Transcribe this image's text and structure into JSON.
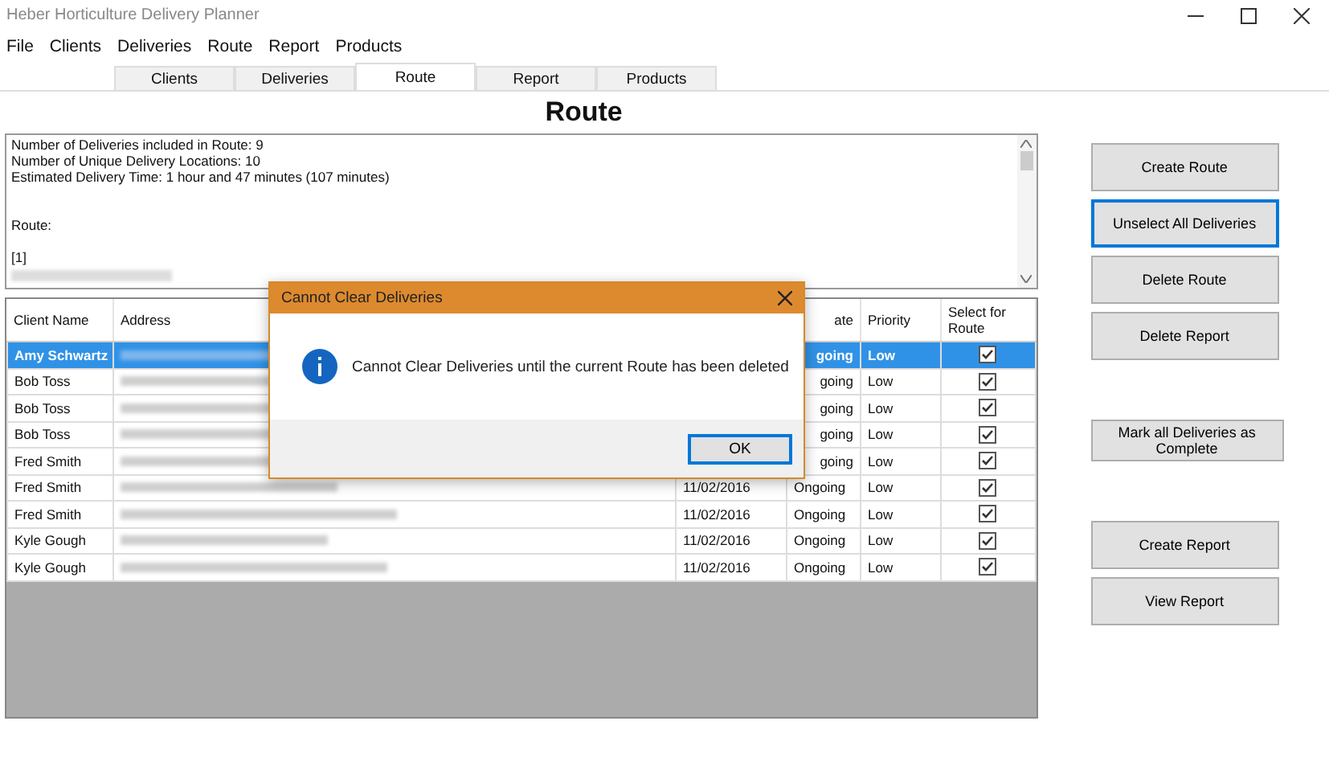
{
  "window": {
    "title": "Heber Horticulture Delivery Planner"
  },
  "menu": [
    "File",
    "Clients",
    "Deliveries",
    "Route",
    "Report",
    "Products"
  ],
  "tabs": [
    {
      "label": "Clients",
      "selected": false
    },
    {
      "label": "Deliveries",
      "selected": false
    },
    {
      "label": "Route",
      "selected": true
    },
    {
      "label": "Report",
      "selected": false
    },
    {
      "label": "Products",
      "selected": false
    }
  ],
  "heading": "Route",
  "summary": {
    "blocks": [
      [
        "Number of Deliveries included in Route: 9",
        "Number of Unique Delivery Locations: 10",
        "Estimated Delivery Time: 1 hour and 47 minutes (107 minutes)"
      ],
      [
        "Route:"
      ],
      [
        "[1]"
      ]
    ]
  },
  "table": {
    "columns": [
      "Client Name",
      "Address",
      "ate",
      "Priority",
      "Select for Route"
    ],
    "rows": [
      {
        "kind": "covered",
        "client": "Amy Schwartz",
        "status": "going",
        "priority": "Low",
        "checked": true,
        "selected": true
      },
      {
        "kind": "covered",
        "client": "Bob Toss",
        "status": "going",
        "priority": "Low",
        "checked": true,
        "selected": false
      },
      {
        "kind": "covered",
        "client": "Bob Toss",
        "status": "going",
        "priority": "Low",
        "checked": true,
        "selected": false
      },
      {
        "kind": "covered",
        "client": "Bob Toss",
        "status": "going",
        "priority": "Low",
        "checked": true,
        "selected": false
      },
      {
        "kind": "covered",
        "client": "Fred Smith",
        "status": "going",
        "priority": "Low",
        "checked": true,
        "selected": false
      },
      {
        "kind": "full",
        "client": "Fred Smith",
        "date": "11/02/2016",
        "status": "Ongoing",
        "priority": "Low",
        "checked": true,
        "selected": false
      },
      {
        "kind": "full",
        "client": "Fred Smith",
        "date": "11/02/2016",
        "status": "Ongoing",
        "priority": "Low",
        "checked": true,
        "selected": false
      },
      {
        "kind": "full",
        "client": "Kyle Gough",
        "date": "11/02/2016",
        "status": "Ongoing",
        "priority": "Low",
        "checked": true,
        "selected": false
      },
      {
        "kind": "full",
        "client": "Kyle Gough",
        "date": "11/02/2016",
        "status": "Ongoing",
        "priority": "Low",
        "checked": true,
        "selected": false
      }
    ]
  },
  "actions": [
    {
      "label": "Create Route",
      "focused": false
    },
    {
      "label": "Unselect All Deliveries",
      "focused": true
    },
    {
      "label": "Delete Route",
      "focused": false
    },
    {
      "label": "Delete Report",
      "focused": false
    },
    {
      "label": "Mark all Deliveries as Complete",
      "focused": false
    },
    {
      "label": "Create Report",
      "focused": false
    },
    {
      "label": "View Report",
      "focused": false
    }
  ],
  "dialog": {
    "title": "Cannot Clear Deliveries",
    "message": "Cannot Clear Deliveries until the current Route has been deleted",
    "button": {
      "label": "OK",
      "focused": true
    }
  }
}
